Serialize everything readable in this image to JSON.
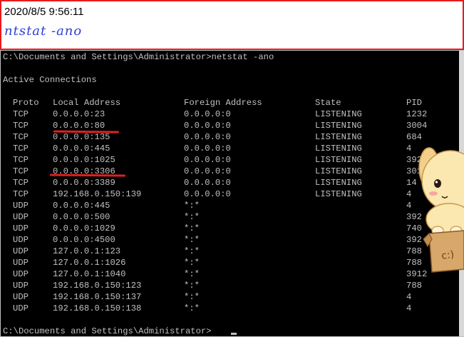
{
  "note": {
    "timestamp": "2020/8/5 9:56:11",
    "command_handwritten": "ntstat -ano"
  },
  "console": {
    "prompt_command": "C:\\Documents and Settings\\Administrator>netstat -ano",
    "heading": "Active Connections",
    "columns": [
      "Proto",
      "Local Address",
      "Foreign Address",
      "State",
      "PID"
    ],
    "rows": [
      [
        "TCP",
        "0.0.0.0:23",
        "0.0.0.0:0",
        "LISTENING",
        "1232"
      ],
      [
        "TCP",
        "0.0.0.0:80",
        "0.0.0.0:0",
        "LISTENING",
        "3004"
      ],
      [
        "TCP",
        "0.0.0.0:135",
        "0.0.0.0:0",
        "LISTENING",
        "684"
      ],
      [
        "TCP",
        "0.0.0.0:445",
        "0.0.0.0:0",
        "LISTENING",
        "4"
      ],
      [
        "TCP",
        "0.0.0.0:1025",
        "0.0.0.0:0",
        "LISTENING",
        "392"
      ],
      [
        "TCP",
        "0.0.0.0:3306",
        "0.0.0.0:0",
        "LISTENING",
        "301"
      ],
      [
        "TCP",
        "0.0.0.0:3389",
        "0.0.0.0:0",
        "LISTENING",
        "14"
      ],
      [
        "TCP",
        "192.168.0.150:139",
        "0.0.0.0:0",
        "LISTENING",
        "4"
      ],
      [
        "UDP",
        "0.0.0.0:445",
        "*:*",
        "",
        "4"
      ],
      [
        "UDP",
        "0.0.0.0:500",
        "*:*",
        "",
        "392"
      ],
      [
        "UDP",
        "0.0.0.0:1029",
        "*:*",
        "",
        "740"
      ],
      [
        "UDP",
        "0.0.0.0:4500",
        "*:*",
        "",
        "392"
      ],
      [
        "UDP",
        "127.0.0.1:123",
        "*:*",
        "",
        "788"
      ],
      [
        "UDP",
        "127.0.0.1:1026",
        "*:*",
        "",
        "788"
      ],
      [
        "UDP",
        "127.0.0.1:1040",
        "*:*",
        "",
        "3912"
      ],
      [
        "UDP",
        "192.168.0.150:123",
        "*:*",
        "",
        "788"
      ],
      [
        "UDP",
        "192.168.0.150:137",
        "*:*",
        "",
        "4"
      ],
      [
        "UDP",
        "192.168.0.150:138",
        "*:*",
        "",
        "4"
      ]
    ],
    "final_prompt": "C:\\Documents and Settings\\Administrator>",
    "underlined_rows": [
      1,
      5
    ]
  },
  "colors": {
    "note_border": "#e8191c",
    "handwriting": "#2b3fd6",
    "console_bg": "#000000",
    "console_text": "#c0c0c0",
    "underline": "#e02020"
  },
  "sticker": {
    "icon": "puppy-in-box-sticker"
  }
}
